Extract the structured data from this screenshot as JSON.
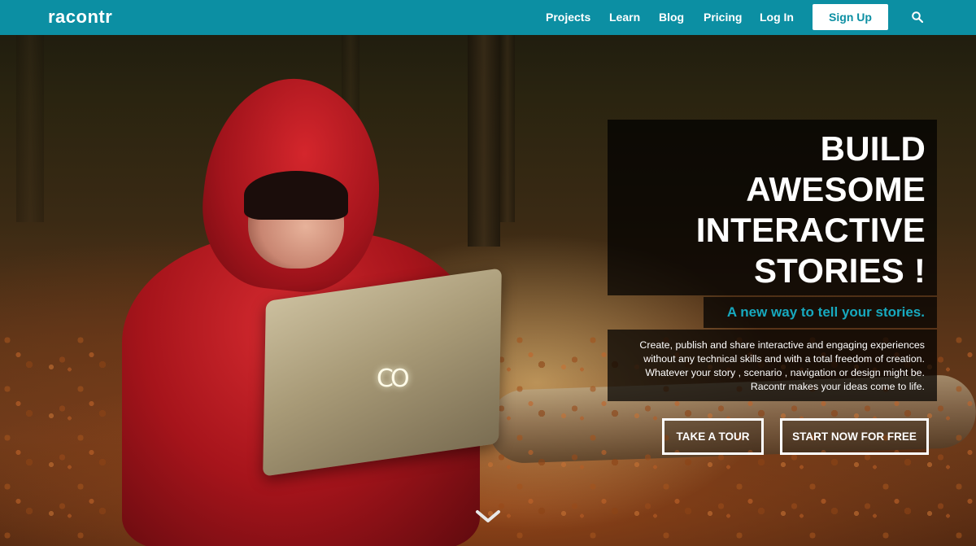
{
  "navbar": {
    "logo": "racontr",
    "links": [
      "Projects",
      "Learn",
      "Blog",
      "Pricing",
      "Log In"
    ],
    "signup_label": "Sign Up",
    "search_icon": "search-icon",
    "background_color": "#0c8fa3"
  },
  "hero": {
    "headline_lines": [
      "BUILD",
      "AWESOME",
      "INTERACTIVE",
      "STORIES !"
    ],
    "tagline": "A new way to tell your stories.",
    "description_lines": [
      "Create, publish and share interactive and engaging experiences",
      "without any technical skills and with a total freedom of creation.",
      "Whatever your story , scenario , navigation or design might be.",
      "Racontr makes your ideas come to life."
    ],
    "cta_tour": "TAKE A TOUR",
    "cta_start": "START NOW FOR FREE",
    "laptop_logo": "CO",
    "scroll_icon": "chevron-down-icon",
    "tagline_color": "#17a9bf"
  }
}
